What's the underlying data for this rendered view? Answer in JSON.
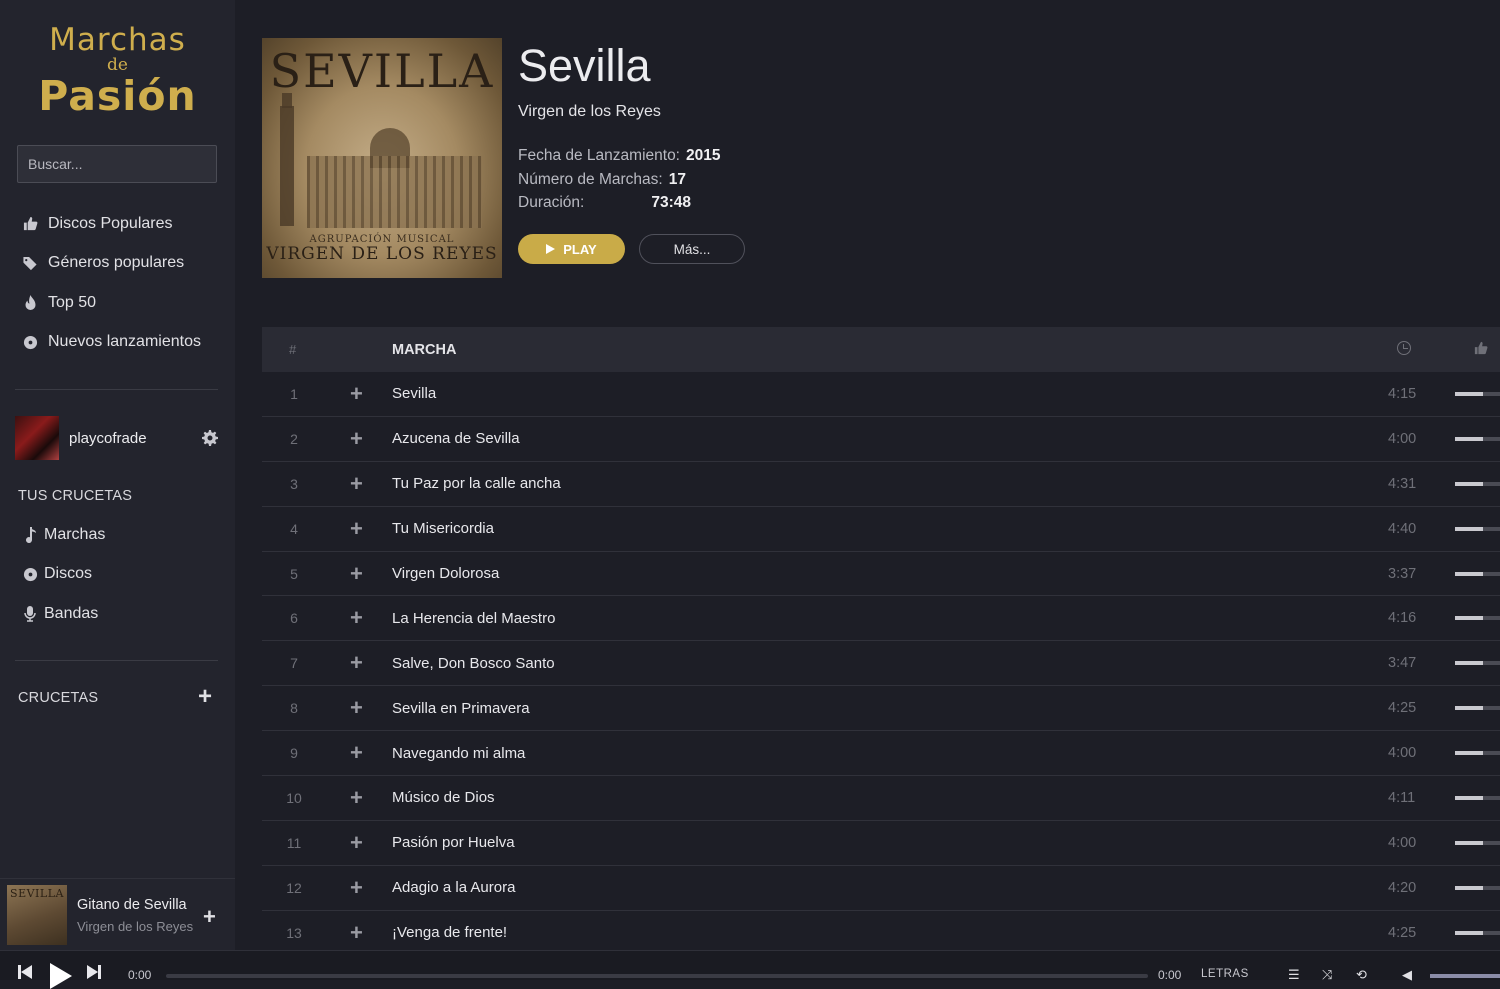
{
  "logo": {
    "line1": "Marchas",
    "line2": "de",
    "line3": "Pasión"
  },
  "search": {
    "placeholder": "Buscar..."
  },
  "nav": [
    {
      "label": "Discos Populares",
      "icon": "thumbs-up-icon"
    },
    {
      "label": "Géneros populares",
      "icon": "tags-icon"
    },
    {
      "label": "Top 50",
      "icon": "fire-icon"
    },
    {
      "label": "Nuevos lanzamientos",
      "icon": "disc-icon"
    }
  ],
  "user": {
    "name": "playcofrade"
  },
  "tus_crucetas": {
    "title": "TUS CRUCETAS",
    "items": [
      {
        "label": "Marchas",
        "icon": "music-note-icon"
      },
      {
        "label": "Discos",
        "icon": "disc-icon"
      },
      {
        "label": "Bandas",
        "icon": "microphone-icon"
      }
    ]
  },
  "crucetas": {
    "title": "CRUCETAS"
  },
  "now_playing": {
    "title": "Gitano de Sevilla",
    "artist": "Virgen de los Reyes",
    "cover_text": "SEVILLA"
  },
  "album": {
    "cover_title": "SEVILLA",
    "cover_sub1": "AGRUPACIÓN MUSICAL",
    "cover_sub2": "VIRGEN DE LOS REYES",
    "title": "Sevilla",
    "artist": "Virgen de los Reyes",
    "release_label": "Fecha de Lanzamiento:",
    "release_value": "2015",
    "count_label": "Número de Marchas:",
    "count_value": "17",
    "duration_label": "Duración:",
    "duration_value": "73:48",
    "play_label": "PLAY",
    "more_label": "Más..."
  },
  "table": {
    "col_num": "#",
    "col_title": "MARCHA",
    "tracks": [
      {
        "n": "1",
        "name": "Sevilla",
        "dur": "4:15"
      },
      {
        "n": "2",
        "name": "Azucena de Sevilla",
        "dur": "4:00"
      },
      {
        "n": "3",
        "name": "Tu Paz por la calle ancha",
        "dur": "4:31"
      },
      {
        "n": "4",
        "name": "Tu Misericordia",
        "dur": "4:40"
      },
      {
        "n": "5",
        "name": "Virgen Dolorosa",
        "dur": "3:37"
      },
      {
        "n": "6",
        "name": "La Herencia del Maestro",
        "dur": "4:16"
      },
      {
        "n": "7",
        "name": "Salve, Don Bosco Santo",
        "dur": "3:47"
      },
      {
        "n": "8",
        "name": "Sevilla en Primavera",
        "dur": "4:25"
      },
      {
        "n": "9",
        "name": "Navegando mi alma",
        "dur": "4:00"
      },
      {
        "n": "10",
        "name": "Músico de Dios",
        "dur": "4:11"
      },
      {
        "n": "11",
        "name": "Pasión por Huelva",
        "dur": "4:00"
      },
      {
        "n": "12",
        "name": "Adagio a la Aurora",
        "dur": "4:20"
      },
      {
        "n": "13",
        "name": "¡Venga de frente!",
        "dur": "4:25"
      }
    ]
  },
  "player": {
    "current_time": "0:00",
    "total_time": "0:00",
    "lyrics_label": "LETRAS"
  }
}
